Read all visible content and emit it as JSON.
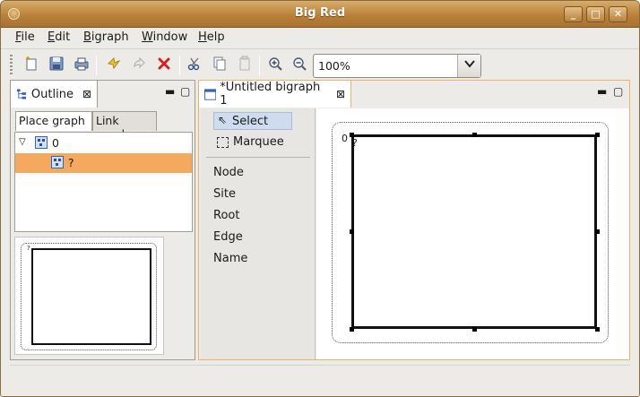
{
  "window": {
    "title": "Big Red",
    "buttons": {
      "minimize": "_",
      "maximize": "□",
      "close": "✕"
    }
  },
  "menubar": {
    "items": [
      {
        "label": "File",
        "mnemonic": "F",
        "rest": "ile"
      },
      {
        "label": "Edit",
        "mnemonic": "E",
        "rest": "dit"
      },
      {
        "label": "Bigraph",
        "mnemonic": "B",
        "rest": "igraph"
      },
      {
        "label": "Window",
        "mnemonic": "W",
        "rest": "indow"
      },
      {
        "label": "Help",
        "mnemonic": "H",
        "rest": "elp"
      }
    ]
  },
  "toolbar": {
    "icons": [
      "new-icon",
      "save-icon",
      "print-icon",
      "undo-icon",
      "redo-icon",
      "delete-icon",
      "cut-icon",
      "copy-icon",
      "paste-icon",
      "zoom-in-icon",
      "zoom-out-icon"
    ],
    "zoom_value": "100%"
  },
  "outline": {
    "title": "Outline",
    "tabs": {
      "place": "Place graph",
      "link": "Link graph"
    },
    "tree": [
      {
        "label": "0",
        "expanded": true
      },
      {
        "label": "?",
        "selected": true
      }
    ],
    "preview_label": "?"
  },
  "editor": {
    "tab_title": "*Untitled bigraph 1",
    "palette": {
      "tools": [
        {
          "label": "Select",
          "selected": true
        },
        {
          "label": "Marquee"
        }
      ],
      "items": [
        "Node",
        "Site",
        "Root",
        "Edge",
        "Name"
      ]
    },
    "canvas": {
      "root_label": "0",
      "node_label": "?"
    }
  },
  "colors": {
    "titlebar": "#b98239",
    "selection": "#f4a95f",
    "active_view_border": "#f0b068"
  }
}
